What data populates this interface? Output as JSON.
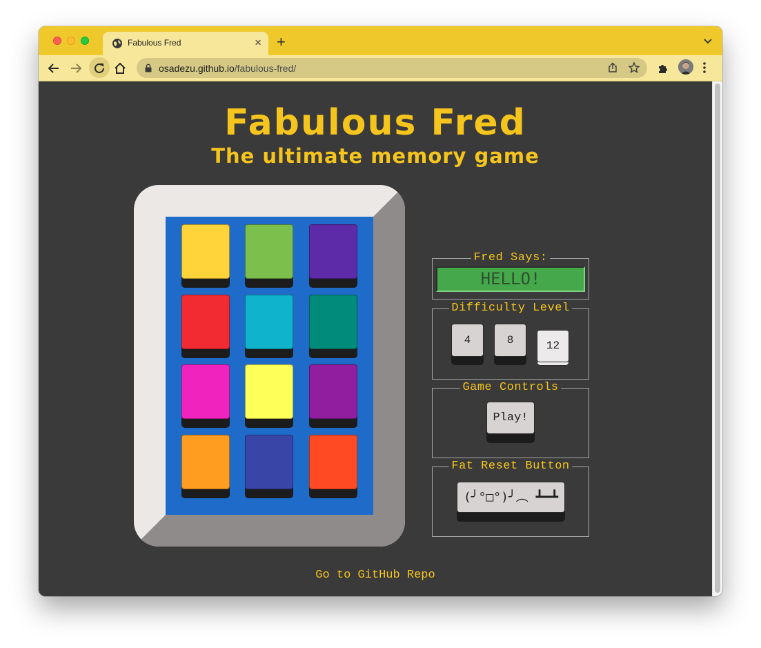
{
  "browser": {
    "tab_title": "Fabulous Fred",
    "tab_close": "×",
    "new_tab": "+",
    "url_host": "osadezu.github.io",
    "url_path": "/fabulous-fred/"
  },
  "header": {
    "title": "Fabulous Fred",
    "subtitle": "The ultimate memory game"
  },
  "pads": [
    {
      "color": "#ffd43b"
    },
    {
      "color": "#7cbf4c"
    },
    {
      "color": "#5e2ba8"
    },
    {
      "color": "#f22a32"
    },
    {
      "color": "#0fb3cc"
    },
    {
      "color": "#008b7a"
    },
    {
      "color": "#f123be"
    },
    {
      "color": "#ffff5a"
    },
    {
      "color": "#901e9e"
    },
    {
      "color": "#ff9d20"
    },
    {
      "color": "#3a45a8"
    },
    {
      "color": "#ff4a24"
    }
  ],
  "panel": {
    "fred_says": {
      "legend": "Fred Says:",
      "display": "HELLO!"
    },
    "difficulty": {
      "legend": "Difficulty Level",
      "levels": [
        {
          "label": "4",
          "selected": false
        },
        {
          "label": "8",
          "selected": false
        },
        {
          "label": "12",
          "selected": true
        }
      ]
    },
    "controls": {
      "legend": "Game Controls",
      "play_label": "Play!"
    },
    "reset": {
      "legend": "Fat Reset Button",
      "reset_label": "(╯°□°)╯︵ ┻━┻"
    }
  },
  "footer": {
    "repo_link": "Go to GitHub Repo"
  },
  "colors": {
    "accent": "#f5c51e",
    "browser_chrome": "#efc92c",
    "page_bg": "#3a3a3a",
    "board_bg": "#1e6bca",
    "display_bg": "#45a84a"
  }
}
